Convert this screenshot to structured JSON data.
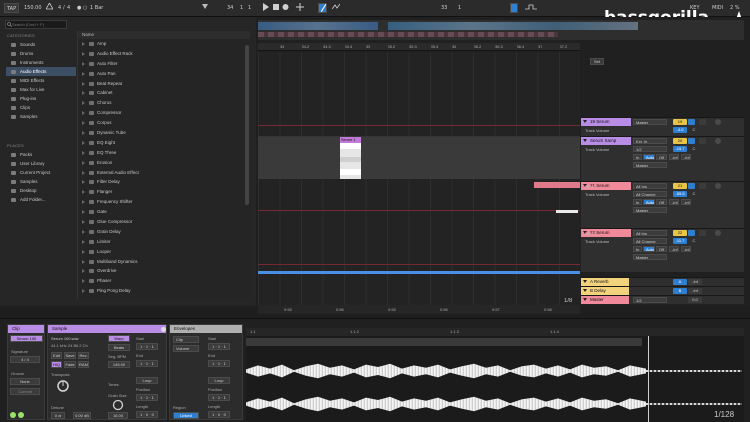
{
  "topbar": {
    "tap": "TAP",
    "tempo": "150.00",
    "time_sig_num": "4",
    "time_sig_den": "4",
    "metro": "● ○",
    "quantize": "1 Bar",
    "pos_bar": "34",
    "pos_beat": "1",
    "pos_sixteenth": "1",
    "loop_start_bar": "33",
    "loop_len": "1",
    "key": "KEY",
    "midi": "MIDI",
    "cpu": "2 %",
    "d": "D"
  },
  "watermark": "bassgorilla",
  "browser": {
    "search_placeholder": "Search (Cmd + F)",
    "categories_header": "CATEGORIES",
    "categories": [
      "Sounds",
      "Drums",
      "Instruments",
      "Audio Effects",
      "MIDI Effects",
      "Max for Live",
      "Plug-ins",
      "Clips",
      "Samples"
    ],
    "selected_category": 3,
    "places_header": "PLACES",
    "places": [
      "Packs",
      "User Library",
      "Current Project",
      "Samples",
      "Desktop",
      "Add Folder..."
    ],
    "names_header": "Name",
    "names": [
      "Amp",
      "Audio Effect Rack",
      "Auto Filter",
      "Auto Pan",
      "Beat Repeat",
      "Cabinet",
      "Chorus",
      "Compressor",
      "Corpus",
      "Dynamic Tube",
      "EQ Eight",
      "EQ Three",
      "Erosion",
      "External Audio Effect",
      "Filter Delay",
      "Flanger",
      "Frequency Shifter",
      "Gate",
      "Glue Compressor",
      "Grain Delay",
      "Limiter",
      "Looper",
      "Multiband Dynamics",
      "Overdrive",
      "Phaser",
      "Ping Pong Delay"
    ]
  },
  "ruler": {
    "ticks": [
      "34",
      "34.2",
      "34.3",
      "34.4",
      "35",
      "35.2",
      "35.3",
      "35.4",
      "36",
      "36.2",
      "36.3",
      "36.4",
      "37",
      "37.2"
    ],
    "bottom_ticks": [
      "0:55",
      "0:56",
      "0:55",
      "0:56",
      "0:57",
      "0:58"
    ],
    "bottom_ratio": "1/8",
    "set": "Set"
  },
  "clip_label": "Serum 1",
  "tracks": [
    {
      "name": "19 Serum",
      "color": "#b98ce6",
      "output": "Master",
      "vol_label": "Track Volume",
      "vol": "-4.0",
      "pan": "C",
      "num": "19"
    },
    {
      "name": "Serum Samp",
      "color": "#b98ce6",
      "input": "Ext. In",
      "input_ch": "1/2",
      "mon": "In",
      "auto": "Auto",
      "off": "Off",
      "output": "Master",
      "vol_label": "Track Volume",
      "vol": "-15.7",
      "pan": "C",
      "num": "20",
      "sends": [
        "-inf",
        "-inf"
      ]
    },
    {
      "name": "21 Serum",
      "color": "#f08a9a",
      "input": "All Ins",
      "input_ch": "All Channe",
      "mon": "In",
      "auto": "Auto",
      "off": "Off",
      "output": "Master",
      "sub": "Mixer",
      "vol_label": "Track Volume",
      "vol": "-59.6",
      "pan": "C",
      "num": "21",
      "sends": [
        "-inf",
        "-inf"
      ]
    },
    {
      "name": "22 Serum",
      "color": "#f08a9a",
      "input": "All Ins",
      "input_ch": "All Channe",
      "mon": "In",
      "auto": "Auto",
      "off": "Off",
      "output": "Master",
      "sub": "Mixer",
      "vol_label": "Track Volume",
      "vol": "-11.7",
      "pan": "C",
      "num": "22",
      "sends": [
        "-inf",
        "-inf"
      ]
    }
  ],
  "returns": [
    {
      "name": "A Reverb",
      "color": "#f2d27a",
      "letter": "A",
      "vol": "-Inf"
    },
    {
      "name": "B Delay",
      "color": "#f2d27a",
      "letter": "B",
      "vol": "-Inf"
    },
    {
      "name": "Master",
      "color": "#f08a9a",
      "cue": "1/2",
      "vol": "0.0"
    }
  ],
  "detail": {
    "clip_panel": {
      "title": "Clip",
      "name": "Serum 100",
      "signature_label": "Signature",
      "sig": "4 / 4",
      "groove_label": "Groove",
      "groove": "None",
      "commit": "Commit"
    },
    "sample_panel": {
      "title": "Sample",
      "file": "Serum 100.wav",
      "info": "44.1 kHz 24 Bit 2 Ch",
      "edit": "Edit",
      "save": "Save",
      "rev": "Rev.",
      "hiq": "HiQ",
      "fade": "Fade",
      "ram": "RAM",
      "transpose": "Transpose",
      "detune": "Detune",
      "detune_val": "0 ct",
      "gain_val": "0.00 dB",
      "warp": "Warp",
      "warp_mode": "Beats",
      "seg_bpm_label": "Seg. BPM",
      "seg_bpm": "145.00",
      "tones": "Tones",
      "grain_size_label": "Grain Size",
      "grain_size": "16.00",
      "start": "Start",
      "end": "End",
      "loop": "Loop",
      "position": "Position",
      "length": "Length"
    },
    "env_panel": {
      "title": "Envelopes",
      "clip": "Clip",
      "volume": "Volume",
      "start": "Start",
      "end": "End",
      "loop": "Loop",
      "position": "Position",
      "length": "Length",
      "region": "Region",
      "linked": "Linked"
    },
    "wave_ticks": [
      "1.1",
      "1.1.2",
      "1.1.3",
      "1.1.4"
    ],
    "wave_ratio": "1/128"
  }
}
